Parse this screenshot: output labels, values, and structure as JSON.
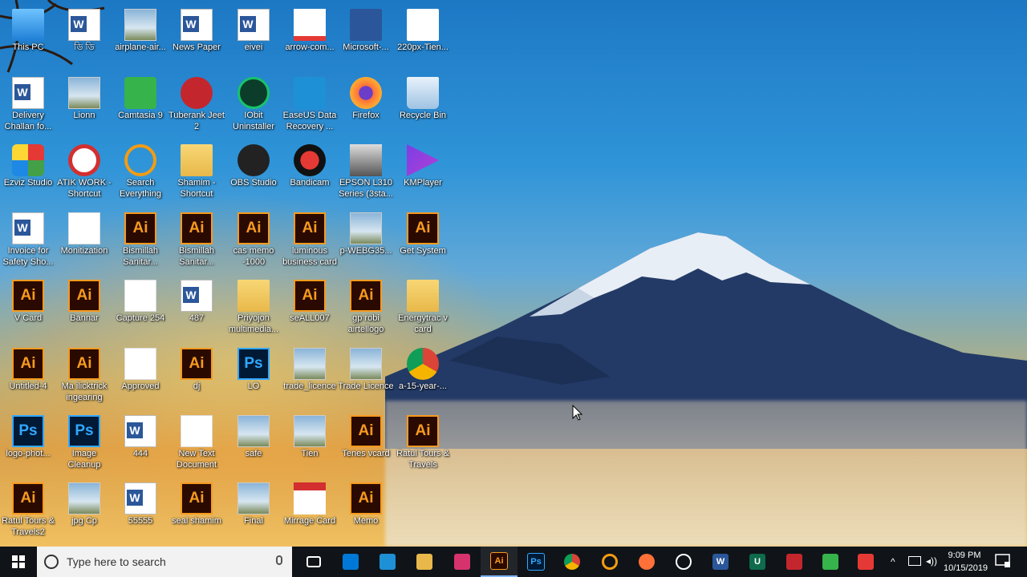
{
  "desktop": {
    "icons": [
      {
        "label": "This PC",
        "type": "pc"
      },
      {
        "label": "Delivery Challan fo...",
        "type": "word"
      },
      {
        "label": "Ezviz Studio",
        "type": "ezviz"
      },
      {
        "label": "Invoice for Safety Sho...",
        "type": "word"
      },
      {
        "label": "V Card",
        "type": "ai"
      },
      {
        "label": "Untitled-4",
        "type": "ai"
      },
      {
        "label": "logo-phot...",
        "type": "ps"
      },
      {
        "label": "Ratul Tours & Travels2",
        "type": "ai"
      },
      {
        "label": "ডি ডি",
        "type": "word"
      },
      {
        "label": "Lionn",
        "type": "img"
      },
      {
        "label": "ATIK WORK - Shortcut",
        "type": "noentry"
      },
      {
        "label": "Monitization",
        "type": "white"
      },
      {
        "label": "Bannar",
        "type": "ai"
      },
      {
        "label": "Ma ilicktrick ingearing",
        "type": "ai"
      },
      {
        "label": "Image Cleanup",
        "type": "ps"
      },
      {
        "label": "jpg Cp",
        "type": "img"
      },
      {
        "label": "airplane-air...",
        "type": "img"
      },
      {
        "label": "Camtasia 9",
        "type": "camtasia"
      },
      {
        "label": "Search Everything",
        "type": "search"
      },
      {
        "label": "Bismillah Sanitar...",
        "type": "ai"
      },
      {
        "label": "Capture 254",
        "type": "white"
      },
      {
        "label": "Approved",
        "type": "white"
      },
      {
        "label": "444",
        "type": "word"
      },
      {
        "label": "55555",
        "type": "word"
      },
      {
        "label": "News Paper",
        "type": "word"
      },
      {
        "label": "Tuberank Jeet 2",
        "type": "tuberank"
      },
      {
        "label": "Shamim - Shortcut",
        "type": "folder"
      },
      {
        "label": "Bismillah Sanitar...",
        "type": "ai"
      },
      {
        "label": "487",
        "type": "word"
      },
      {
        "label": "dj",
        "type": "ai"
      },
      {
        "label": "New Text Document",
        "type": "white"
      },
      {
        "label": "seal shamim",
        "type": "ai"
      },
      {
        "label": "eivei",
        "type": "word"
      },
      {
        "label": "IObit Uninstaller",
        "type": "iobit"
      },
      {
        "label": "OBS Studio",
        "type": "obs"
      },
      {
        "label": "cas memo -1000",
        "type": "ai"
      },
      {
        "label": "Priyojon multimedia...",
        "type": "folder"
      },
      {
        "label": "LO",
        "type": "ps"
      },
      {
        "label": "safe",
        "type": "img"
      },
      {
        "label": "Final",
        "type": "img"
      },
      {
        "label": "arrow-com...",
        "type": "arrow"
      },
      {
        "label": "EaseUS Data Recovery ...",
        "type": "easeus"
      },
      {
        "label": "Bandicam",
        "type": "bandicam"
      },
      {
        "label": "luminous business card",
        "type": "ai"
      },
      {
        "label": "seALL007",
        "type": "ai"
      },
      {
        "label": "trade_licence",
        "type": "img"
      },
      {
        "label": "Tien",
        "type": "img"
      },
      {
        "label": "Mirrage Card",
        "type": "pdf"
      },
      {
        "label": "Microsoft-...",
        "type": "msword"
      },
      {
        "label": "Firefox",
        "type": "firefox"
      },
      {
        "label": "EPSON L310 Series (3sta...",
        "type": "printer"
      },
      {
        "label": "p-WEBG35...",
        "type": "img"
      },
      {
        "label": "gp robi airtellogo",
        "type": "ai"
      },
      {
        "label": "Trade Licence",
        "type": "img"
      },
      {
        "label": "Tenes vcard",
        "type": "ai"
      },
      {
        "label": "Memo",
        "type": "ai"
      },
      {
        "label": "220px-Tien...",
        "type": "tiens"
      },
      {
        "label": "Recycle Bin",
        "type": "recycle"
      },
      {
        "label": "KMPlayer",
        "type": "kmp"
      },
      {
        "label": "Get System",
        "type": "ai"
      },
      {
        "label": "Energytrac v card",
        "type": "folder"
      },
      {
        "label": "a-15-year-...",
        "type": "chrome"
      },
      {
        "label": "Ratul Tours & Travels",
        "type": "ai"
      }
    ]
  },
  "taskbar": {
    "search_placeholder": "Type here to search",
    "pinned": [
      {
        "name": "task-view",
        "label": "",
        "color": "#101418"
      },
      {
        "name": "store",
        "label": "",
        "color": "#0078d7"
      },
      {
        "name": "snip",
        "label": "",
        "color": "#1e90d6"
      },
      {
        "name": "file-explorer",
        "label": "",
        "color": "#e8b84a"
      },
      {
        "name": "paint",
        "label": "",
        "color": "#d6336c"
      },
      {
        "name": "illustrator",
        "label": "Ai",
        "color": "#2a0a00"
      },
      {
        "name": "photoshop",
        "label": "Ps",
        "color": "#001a36"
      },
      {
        "name": "chrome",
        "label": "",
        "color": "#ffffff"
      },
      {
        "name": "search-everything",
        "label": "",
        "color": "#101418"
      },
      {
        "name": "firefox",
        "label": "",
        "color": "#ff7139"
      },
      {
        "name": "clock-app",
        "label": "",
        "color": "#101418"
      },
      {
        "name": "word",
        "label": "W",
        "color": "#2b579a"
      },
      {
        "name": "iobit",
        "label": "U",
        "color": "#0e6b4b"
      },
      {
        "name": "tuberank",
        "label": "",
        "color": "#c4262e"
      },
      {
        "name": "camtasia",
        "label": "",
        "color": "#36b34a"
      },
      {
        "name": "screen-recorder",
        "label": "",
        "color": "#e53935"
      }
    ],
    "clock": {
      "time": "9:09 PM",
      "date": "10/15/2019"
    }
  }
}
